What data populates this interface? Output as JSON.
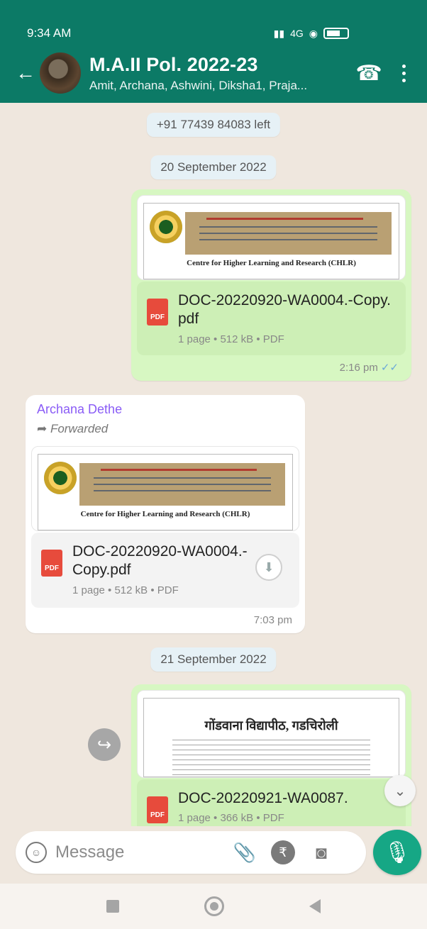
{
  "status_bar": {
    "time": "9:34 AM",
    "network": "4G",
    "battery": "6"
  },
  "header": {
    "title": "M.A.II Pol. 2022-23",
    "subtitle": "Amit, Archana, Ashwini, Diksha1, Praja..."
  },
  "system_msg": "+91 77439 84083 left",
  "dates": {
    "d1": "20 September 2022",
    "d2": "21 September 2022"
  },
  "messages": {
    "m1": {
      "preview_line": "Centre for Higher Learning and Research (CHLR)",
      "file_name": "DOC-20220920-WA0004.-Copy.pdf",
      "file_meta": "1 page • 512 kB • PDF",
      "time": "2:16 pm",
      "ticks": "✓✓"
    },
    "m2": {
      "sender": "Archana Dethe",
      "forwarded": "Forwarded",
      "preview_line": "Centre for Higher Learning and Research (CHLR)",
      "file_name": "DOC-20220920-WA0004.-Copy.pdf",
      "file_meta": "1 page • 512 kB • PDF",
      "time": "7:03 pm"
    },
    "m3": {
      "preview_line": "गोंडवाना विद्यापीठ, गडचिरोली",
      "file_name": "DOC-20220921-WA0087.",
      "file_meta": "1 page • 366 kB • PDF"
    }
  },
  "icons": {
    "pdf": "PDF",
    "download": "⬇",
    "forward": "↪",
    "scroll": "⌄"
  },
  "input": {
    "placeholder": "Message"
  },
  "colors": {
    "header": "#0c7a66",
    "outgoing": "#d7f7c2",
    "incoming": "#ffffff",
    "accent": "#16a785",
    "sender": "#8a5cf6"
  }
}
